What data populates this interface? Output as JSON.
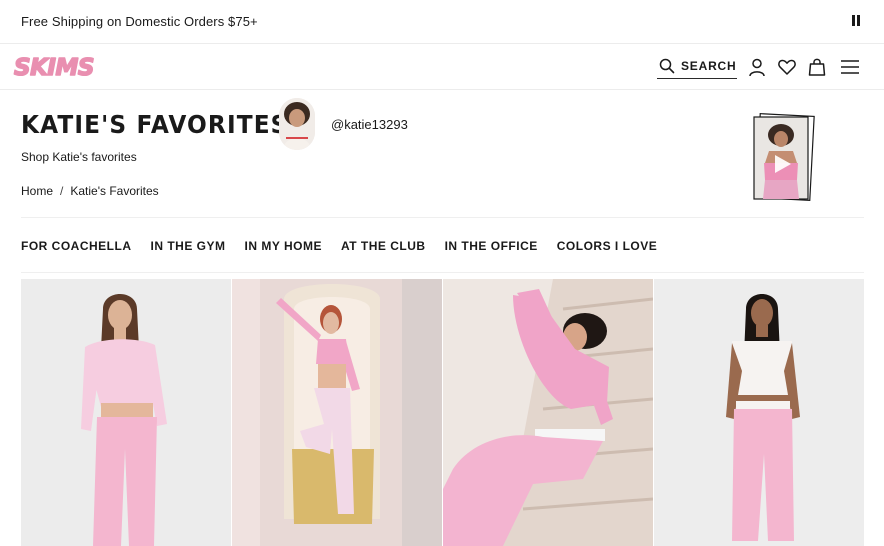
{
  "promo": {
    "text": "Free Shipping on Domestic Orders $75+"
  },
  "header": {
    "logo_text": "SKIMS",
    "search_label": "SEARCH"
  },
  "hero": {
    "title": "KATIE'S FAVORITES",
    "subtitle": "Shop Katie's favorites",
    "handle": "@katie13293"
  },
  "breadcrumb": {
    "home": "Home",
    "separator": "/",
    "current": "Katie's Favorites"
  },
  "tabs": [
    "FOR COACHELLA",
    "IN THE GYM",
    "IN MY HOME",
    "AT THE CLUB",
    "IN THE OFFICE",
    "COLORS I LOVE"
  ],
  "products": [
    {
      "image": "model-pink-off-shoulder-top-and-joggers"
    },
    {
      "image": "model-pink-crop-top-and-flare-pants"
    },
    {
      "image": "model-pink-sweatshirt-on-stairs"
    },
    {
      "image": "model-white-tee-and-pink-joggers"
    }
  ],
  "colors": {
    "brand_pink": "#e98fb0",
    "text": "#1a1a1a",
    "product_pink": "#f4b6cf"
  }
}
